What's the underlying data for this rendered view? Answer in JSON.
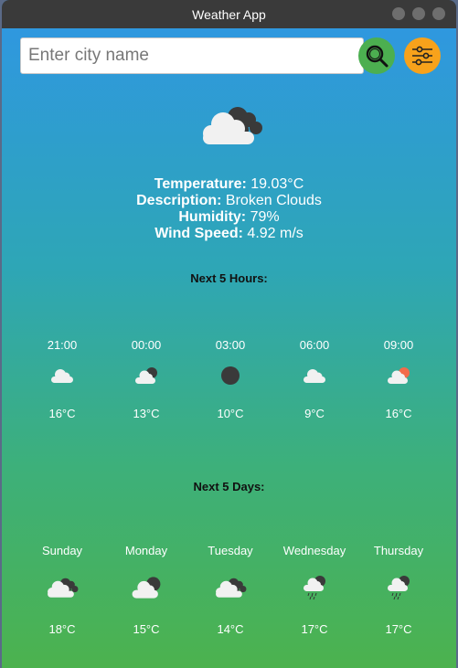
{
  "window": {
    "title": "Weather App"
  },
  "search": {
    "placeholder": "Enter city name",
    "button_icon": "search-icon",
    "filter_icon": "sliders-icon"
  },
  "current": {
    "icon": "broken-clouds-icon",
    "temperature_label": "Temperature:",
    "temperature": "19.03°C",
    "description_label": "Description:",
    "description": "Broken Clouds",
    "humidity_label": "Humidity:",
    "humidity": "79%",
    "wind_label": "Wind Speed:",
    "wind": "4.92 m/s"
  },
  "hours": {
    "title": "Next 5 Hours:",
    "items": [
      {
        "time": "21:00",
        "icon": "cloud-icon",
        "temp": "16°C"
      },
      {
        "time": "00:00",
        "icon": "cloud-night-icon",
        "temp": "13°C"
      },
      {
        "time": "03:00",
        "icon": "moon-icon",
        "temp": "10°C"
      },
      {
        "time": "06:00",
        "icon": "cloud-icon",
        "temp": "9°C"
      },
      {
        "time": "09:00",
        "icon": "cloud-sun-icon",
        "temp": "16°C"
      }
    ]
  },
  "days": {
    "title": "Next 5 Days:",
    "items": [
      {
        "day": "Sunday",
        "icon": "broken-clouds-icon",
        "temp": "18°C"
      },
      {
        "day": "Monday",
        "icon": "cloud-night-icon",
        "temp": "15°C"
      },
      {
        "day": "Tuesday",
        "icon": "broken-clouds-icon",
        "temp": "14°C"
      },
      {
        "day": "Wednesday",
        "icon": "rain-cloud-icon",
        "temp": "17°C"
      },
      {
        "day": "Thursday",
        "icon": "rain-cloud-icon",
        "temp": "17°C"
      }
    ]
  },
  "colors": {
    "search_button": "#4caf50",
    "filter_button": "#f7a21b",
    "titlebar": "#3a3a3a"
  }
}
